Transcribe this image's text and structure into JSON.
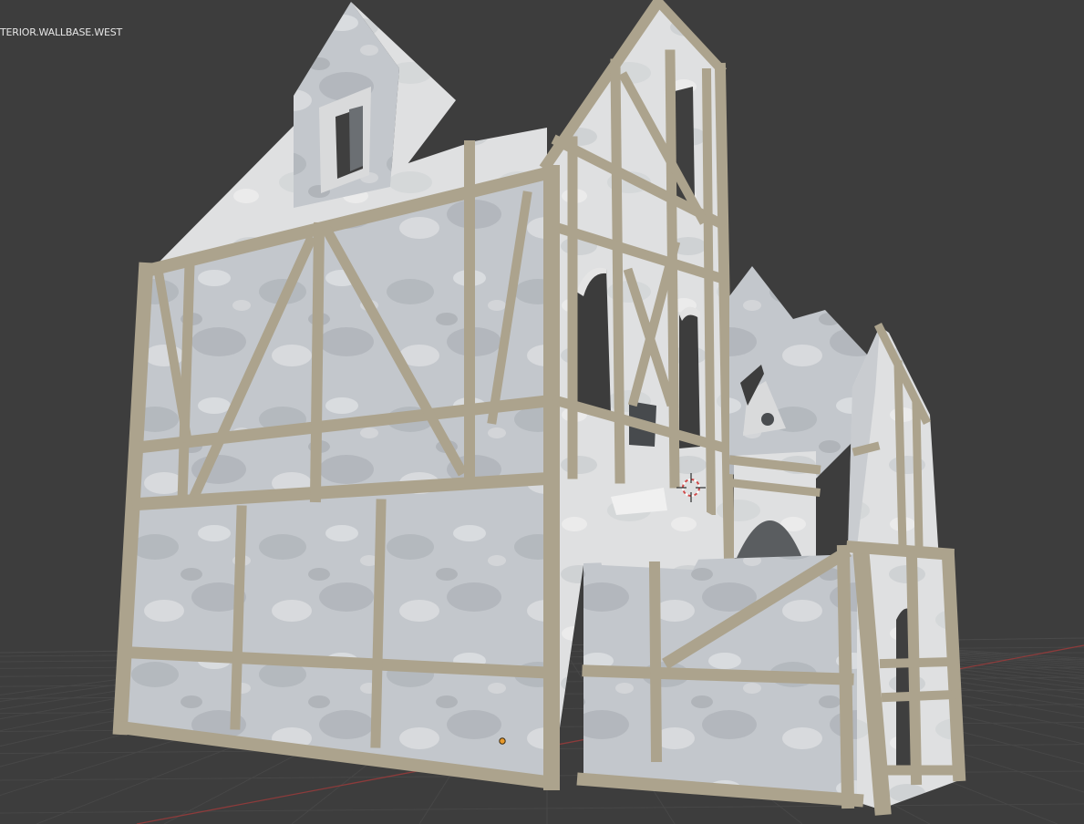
{
  "viewport": {
    "object_label": "TERIOR.WALLBASE.WEST",
    "background_color": "#3d3d3d",
    "grid_line_color": "#474747",
    "x_axis_color": "#9a3b3b",
    "timber_color": "#aea58f",
    "timber_shade_color": "#8f876f",
    "plaster_color": "#c2c6cb",
    "plaster_light_color": "#e3e4e5",
    "plaster_stain_color": "#9ea3a8",
    "origin_dot_color": "#e89a2c",
    "cursor_color": "#d04a4a"
  },
  "icons": {
    "cursor": "3d-cursor-icon",
    "origin": "object-origin-icon"
  }
}
